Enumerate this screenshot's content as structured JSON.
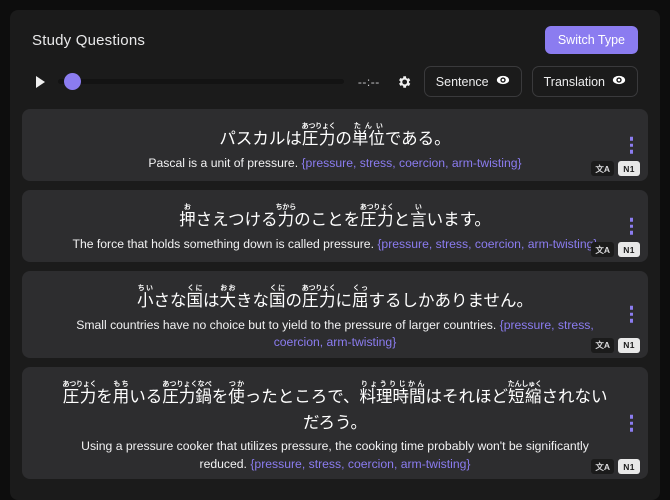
{
  "header": {
    "title": "Study Questions",
    "switch_type_label": "Switch Type",
    "accent_color": "#8b7cf0"
  },
  "toolbar": {
    "play_icon": "play-icon",
    "seek_position_percent": 0,
    "time_display": "--:--",
    "settings_icon": "gear-icon",
    "buttons": [
      {
        "label": "Sentence",
        "icon": "eye-icon"
      },
      {
        "label": "Translation",
        "icon": "eye-icon"
      }
    ]
  },
  "cards": [
    {
      "japanese_plain": "パスカルは圧力の単位である。",
      "furigana": [
        {
          "base": "パスカルは",
          "reading": ""
        },
        {
          "base": "圧力",
          "reading": "あつりょく"
        },
        {
          "base": "の",
          "reading": ""
        },
        {
          "base": "単位",
          "reading": "たんい"
        },
        {
          "base": "である。",
          "reading": ""
        }
      ],
      "translation": "Pascal is a unit of pressure.",
      "gloss": "{pressure, stress, coercion, arm-twisting}",
      "badge_translate": "文A",
      "badge_level": "N1",
      "menu_icon": "kebab-menu-icon"
    },
    {
      "japanese_plain": "押さえつける力のことを圧力と言います。",
      "furigana": [
        {
          "base": "押",
          "reading": "お"
        },
        {
          "base": "さえつける",
          "reading": ""
        },
        {
          "base": "力",
          "reading": "ちから"
        },
        {
          "base": "のことを",
          "reading": ""
        },
        {
          "base": "圧力",
          "reading": "あつりょく"
        },
        {
          "base": "と",
          "reading": ""
        },
        {
          "base": "言",
          "reading": "い"
        },
        {
          "base": "います。",
          "reading": ""
        }
      ],
      "translation": "The force that holds something down is called pressure.",
      "gloss": "{pressure, stress, coercion, arm-twisting}",
      "badge_translate": "文A",
      "badge_level": "N1",
      "menu_icon": "kebab-menu-icon"
    },
    {
      "japanese_plain": "小さな国は大きな国の圧力に屈するしかありません。",
      "furigana": [
        {
          "base": "小",
          "reading": "ちい"
        },
        {
          "base": "さな",
          "reading": ""
        },
        {
          "base": "国",
          "reading": "くに"
        },
        {
          "base": "は",
          "reading": ""
        },
        {
          "base": "大",
          "reading": "おお"
        },
        {
          "base": "きな",
          "reading": ""
        },
        {
          "base": "国",
          "reading": "くに"
        },
        {
          "base": "の",
          "reading": ""
        },
        {
          "base": "圧力",
          "reading": "あつりょく"
        },
        {
          "base": "に",
          "reading": ""
        },
        {
          "base": "屈",
          "reading": "くっ"
        },
        {
          "base": "するしかありません。",
          "reading": ""
        }
      ],
      "translation": "Small countries have no choice but to yield to the pressure of larger countries.",
      "gloss": "{pressure, stress, coercion, arm-twisting}",
      "badge_translate": "文A",
      "badge_level": "N1",
      "menu_icon": "kebab-menu-icon"
    },
    {
      "japanese_plain": "圧力を用いる圧力鍋を使ったところで、料理時間はそれほど短縮されないだろう。",
      "furigana": [
        {
          "base": "圧力",
          "reading": "あつりょく"
        },
        {
          "base": "を",
          "reading": ""
        },
        {
          "base": "用",
          "reading": "もち"
        },
        {
          "base": "いる",
          "reading": ""
        },
        {
          "base": "圧力鍋",
          "reading": "あつりょくなべ"
        },
        {
          "base": "を",
          "reading": ""
        },
        {
          "base": "使",
          "reading": "つか"
        },
        {
          "base": "ったところで、",
          "reading": ""
        },
        {
          "base": "料理時間",
          "reading": "りょうりじかん"
        },
        {
          "base": "はそれほど",
          "reading": ""
        },
        {
          "base": "短縮",
          "reading": "たんしゅく"
        },
        {
          "base": "されないだろう。",
          "reading": ""
        }
      ],
      "translation": "Using a pressure cooker that utilizes pressure, the cooking time probably won't be significantly reduced.",
      "gloss": "{pressure, stress, coercion, arm-twisting}",
      "badge_translate": "文A",
      "badge_level": "N1",
      "menu_icon": "kebab-menu-icon"
    }
  ]
}
